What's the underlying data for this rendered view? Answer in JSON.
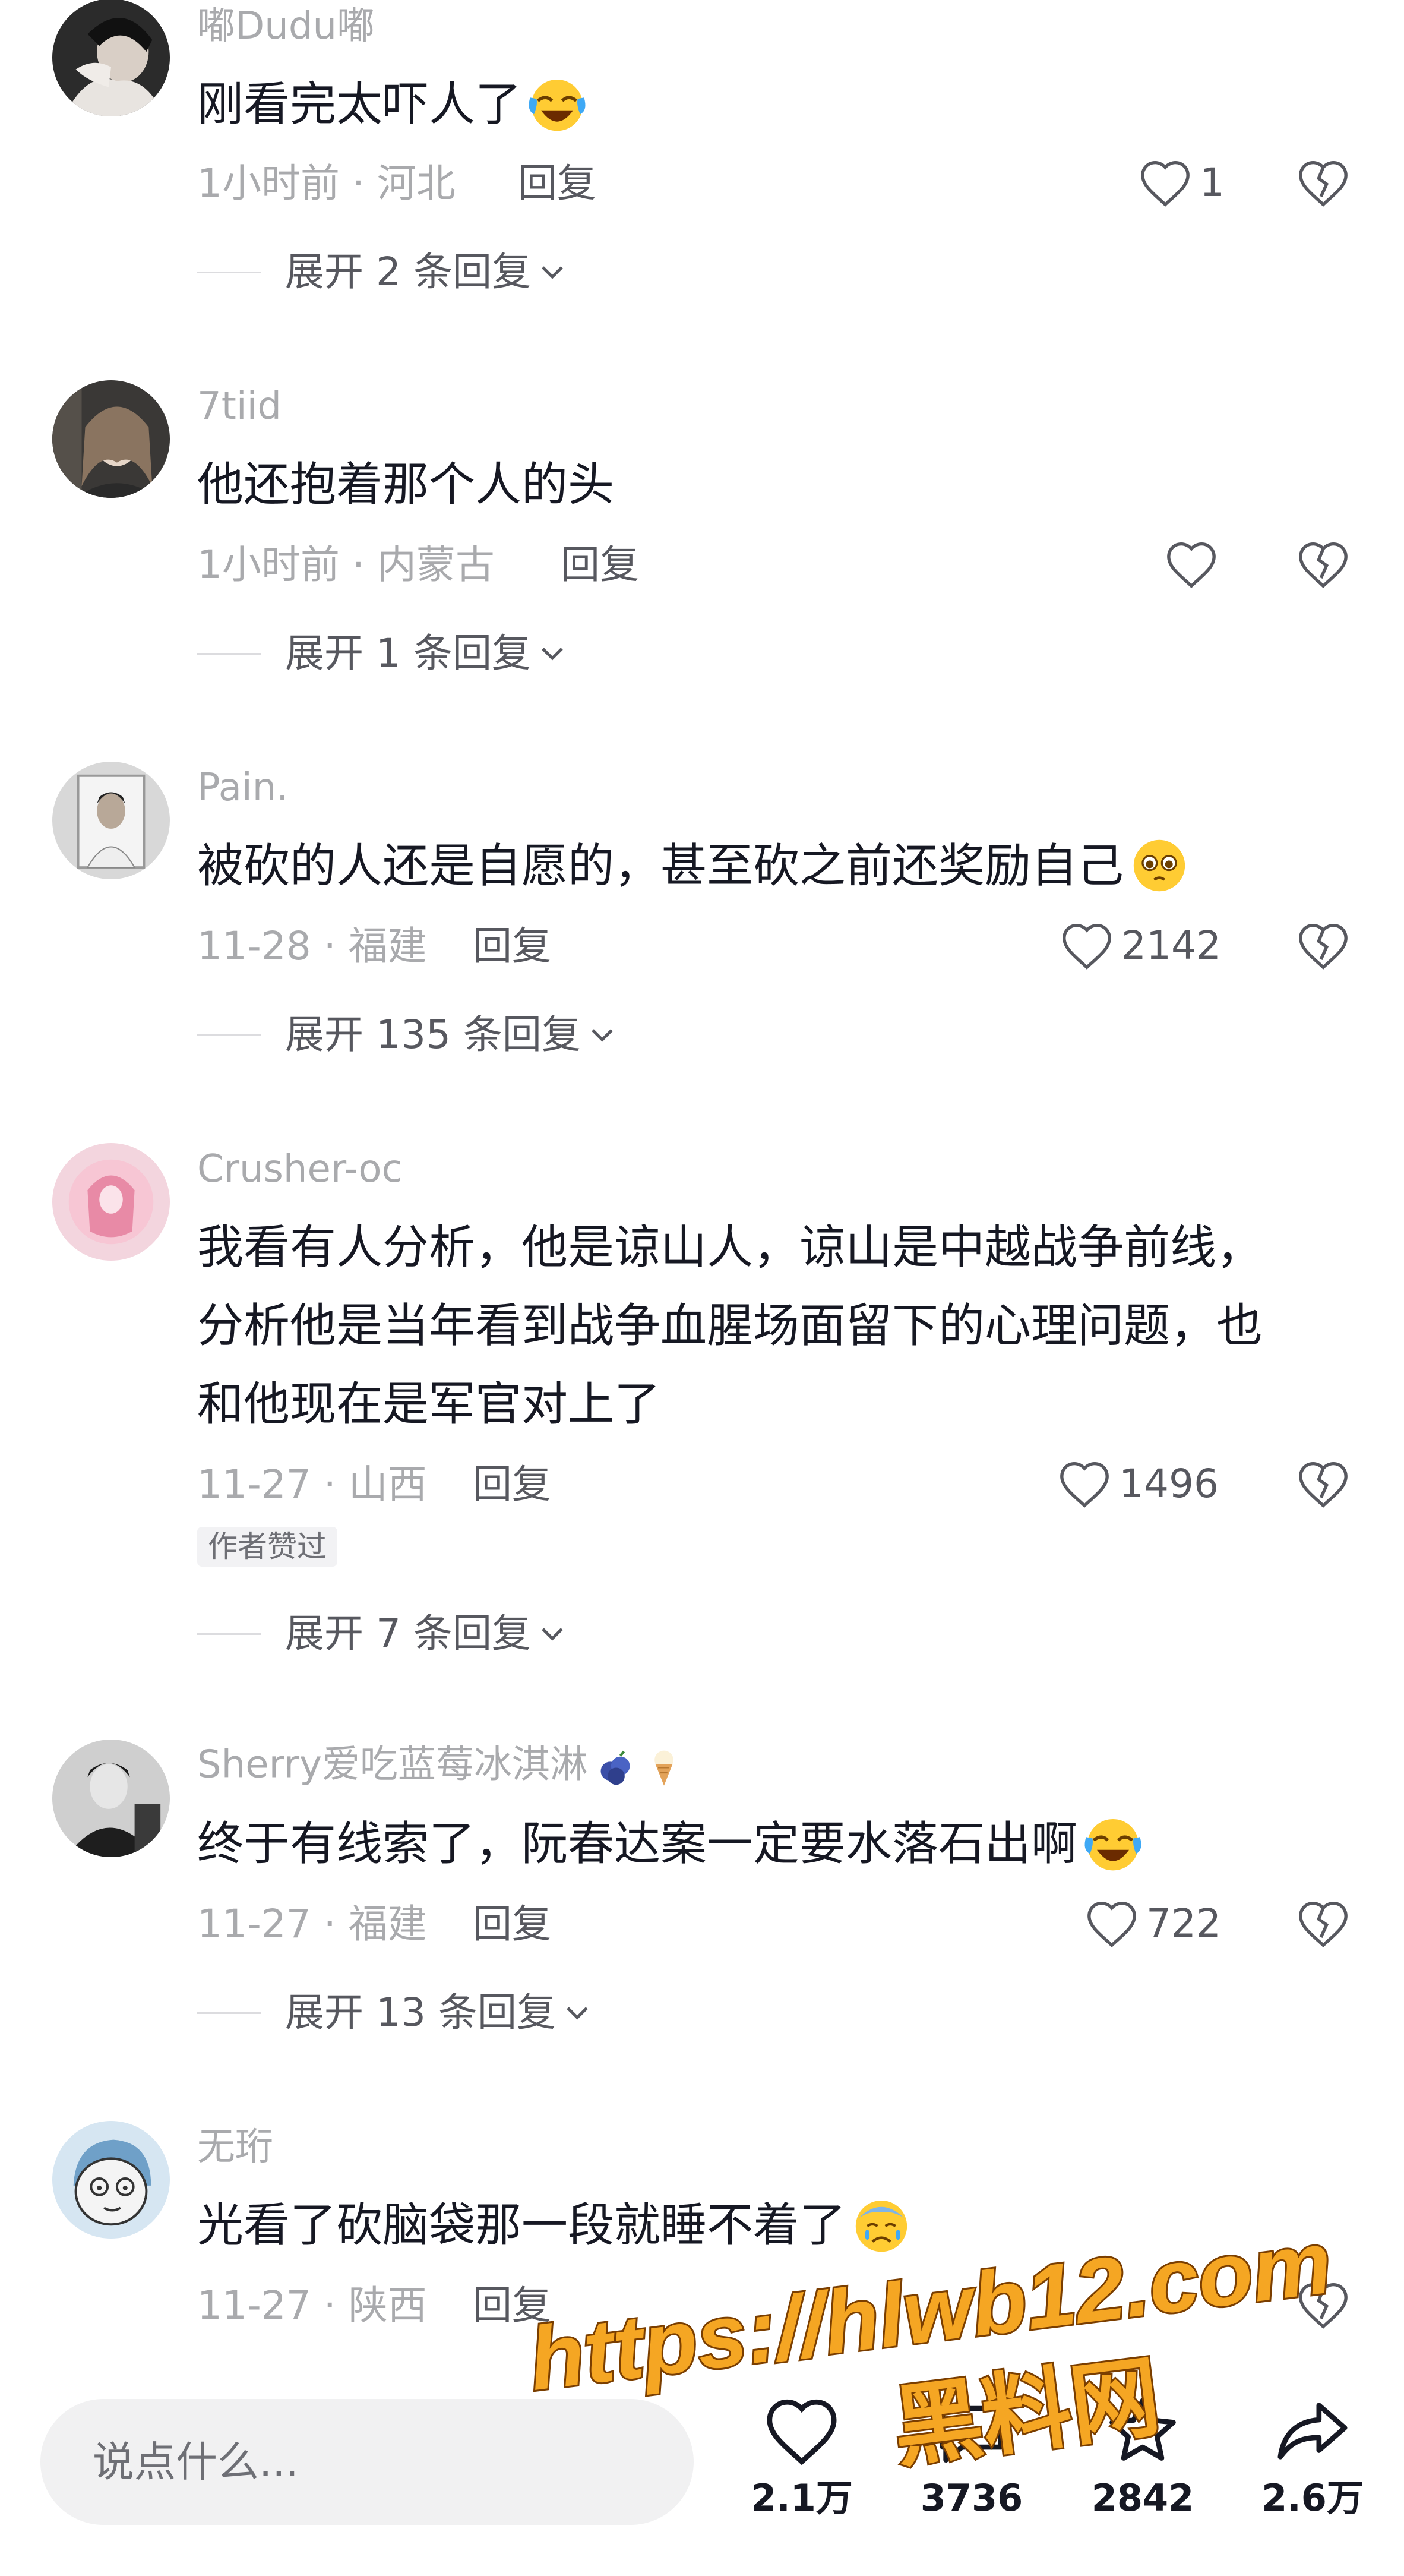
{
  "comments": [
    {
      "username": "嘟Dudu嘟",
      "text": "刚看完太吓人了",
      "time_location": "1小时前 · 河北",
      "reply": "回复",
      "likes": "1",
      "expand": "展开 2 条回复",
      "emoji": "laughing-crying-emoji"
    },
    {
      "username": "7tiid",
      "text": "他还抱着那个人的头",
      "time_location": "1小时前 · 内蒙古",
      "reply": "回复",
      "likes": "",
      "expand": "展开 1 条回复"
    },
    {
      "username": "Pain.",
      "text": "被砍的人还是自愿的，甚至砍之前还奖励自己",
      "time_location": "11-28 · 福建",
      "reply": "回复",
      "likes": "2142",
      "expand": "展开 135 条回复",
      "emoji": "pleading-face-emoji"
    },
    {
      "username": "Crusher-oc",
      "text_lines": [
        "我看有人分析，他是谅山人，谅山是中越战争前线，",
        "分析他是当年看到战争血腥场面留下的心理问题，也",
        "和他现在是军官对上了"
      ],
      "time_location": "11-27 · 山西",
      "reply": "回复",
      "likes": "1496",
      "badge": "作者赞过",
      "expand": "展开 7 条回复"
    },
    {
      "username": "Sherry爱吃蓝莓冰淇淋",
      "text": "终于有线索了，阮春达案一定要水落石出啊",
      "time_location": "11-27 · 福建",
      "reply": "回复",
      "likes": "722",
      "expand": "展开 13 条回复",
      "emoji": "laughing-crying-emoji"
    },
    {
      "username": "无珩",
      "text": "光看了砍脑袋那一段就睡不着了",
      "time_location": "11-27 · 陕西",
      "reply": "回复",
      "emoji": "sad-sweat-emoji"
    }
  ],
  "input": {
    "placeholder": "说点什么..."
  },
  "actions": [
    {
      "name": "like",
      "count": "2.1万"
    },
    {
      "name": "comment",
      "count": "3736"
    },
    {
      "name": "favorite",
      "count": "2842"
    },
    {
      "name": "share",
      "count": "2.6万"
    }
  ],
  "watermark": {
    "line1": "https://hlwb12.com",
    "line2": "黑料网"
  },
  "colors": {
    "accent_watermark": "#f5a623",
    "text_primary": "#161823",
    "text_secondary": "#a9aaad"
  }
}
